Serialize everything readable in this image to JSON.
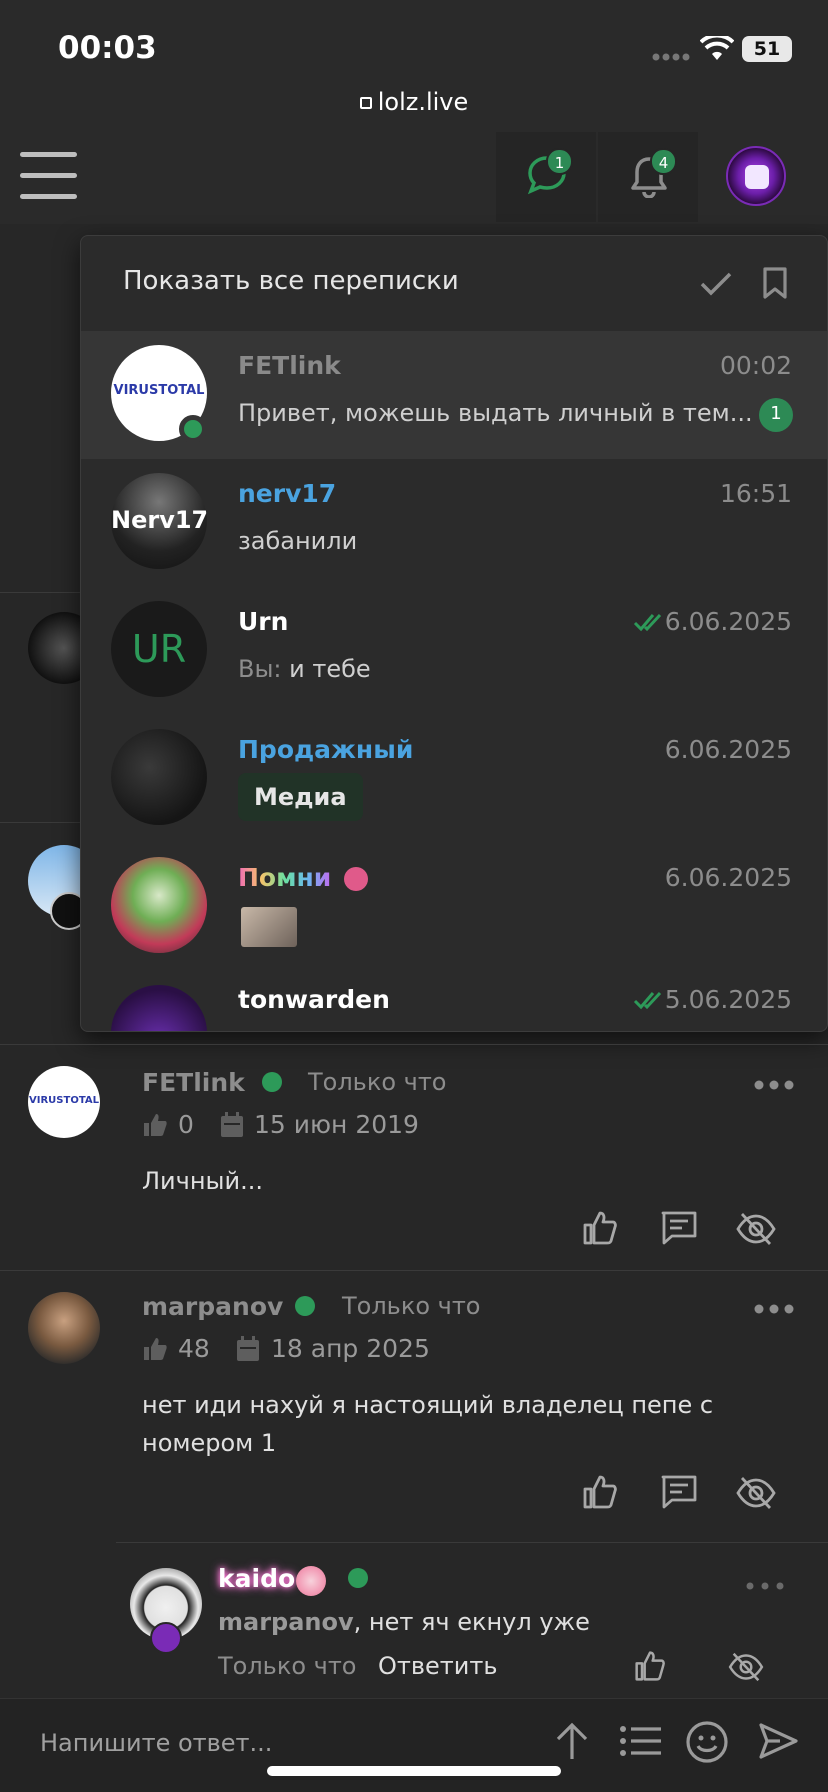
{
  "status_bar": {
    "time": "00:03",
    "battery": "51",
    "url": "lolz.live"
  },
  "header": {
    "messages_badge": "1",
    "alerts_badge": "4"
  },
  "conversations_panel": {
    "title": "Показать все переписки",
    "items": [
      {
        "name": "FETlink",
        "time": "00:02",
        "message": "Привет, можешь выдать личный в тем...",
        "unread": "1",
        "name_color": "#8a8a8a",
        "avatar_text": "VIRUSTOTAL"
      },
      {
        "name": "nerv17",
        "time": "16:51",
        "message": "забанили",
        "name_color": "#4aa3e0",
        "avatar_text": "Nerv17"
      },
      {
        "name": "Urn",
        "time": "6.06.2025",
        "message_prefix": "Вы:",
        "message": "и тебе",
        "name_color": "#ffffff",
        "avatar_text": "UR",
        "read": true
      },
      {
        "name": "Продажный",
        "time": "6.06.2025",
        "media_label": "Медиа",
        "name_color": "#4aa3e0"
      },
      {
        "name": "Помни",
        "time": "6.06.2025",
        "name_color": "#e28bd0"
      },
      {
        "name": "tonwarden",
        "time": "5.06.2025",
        "name_color": "#ffffff",
        "read": true
      }
    ]
  },
  "posts": [
    {
      "author": "FETlink",
      "status": "Только что",
      "likes": "0",
      "date": "15 июн 2019",
      "text": "Личный...",
      "avatar_text": "VIRUSTOTAL"
    },
    {
      "author": "marpanov",
      "status": "Только что",
      "likes": "48",
      "date": "18 апр 2025",
      "text": "нет иди нахуй я настоящий владелец пепе с номером 1"
    }
  ],
  "reply": {
    "author": "kaido",
    "mention": "marpanov",
    "text": ", нет яч екнул уже",
    "time": "Только что",
    "reply_label": "Ответить"
  },
  "composer": {
    "placeholder": "Напишите ответ..."
  }
}
